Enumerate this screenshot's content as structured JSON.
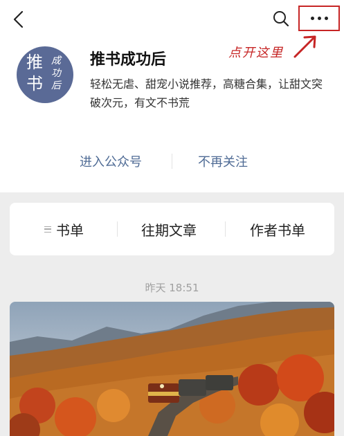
{
  "nav": {
    "back_icon": "chevron-left-icon",
    "search_icon": "search-icon",
    "more_icon": "more-dots-icon"
  },
  "annotation": {
    "text": "点开这里",
    "color": "#c62525"
  },
  "profile": {
    "avatar": {
      "big_line1": "推",
      "big_line2": "书",
      "small_text": "成功后",
      "color": "#5a6a96"
    },
    "name": "推书成功后",
    "description": "轻松无虐、甜宠小说推荐，高糖合集，让甜文突破次元，有文不书荒"
  },
  "actions": {
    "enter_label": "进入公众号",
    "unfollow_label": "不再关注",
    "color": "#4f6b95"
  },
  "menu": {
    "items": [
      {
        "label": "书单",
        "icon": "list-icon"
      },
      {
        "label": "往期文章"
      },
      {
        "label": "作者书单"
      }
    ]
  },
  "feed": {
    "timestamp": "昨天 18:51"
  }
}
